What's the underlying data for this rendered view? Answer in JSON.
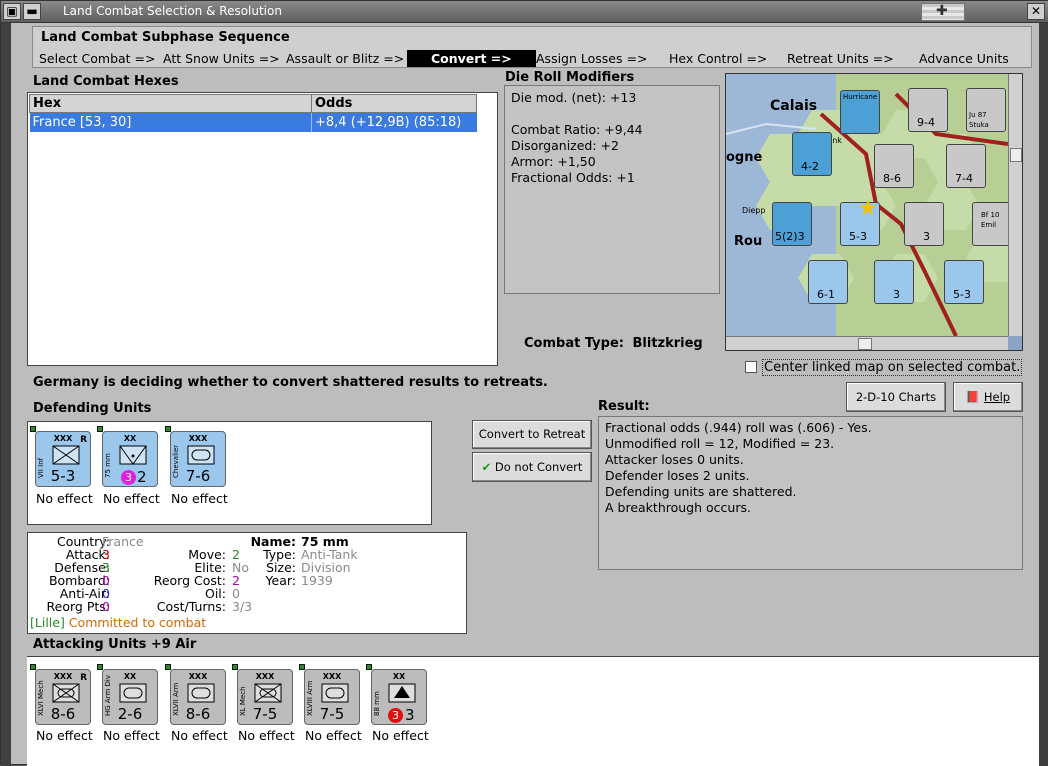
{
  "window": {
    "title": "Land Combat Selection & Resolution"
  },
  "sequence": {
    "header": "Land Combat Subphase Sequence",
    "steps": [
      "Select Combat =>",
      "Att Snow Units =>",
      "Assault or Blitz =>",
      "Convert =>",
      "Assign Losses =>",
      "Hex Control =>",
      "Retreat Units =>",
      "Advance Units"
    ],
    "active_step": "Convert =>"
  },
  "hexes": {
    "label": "Land Combat Hexes",
    "columns": [
      "Hex",
      "Odds"
    ],
    "rows": [
      {
        "hex": "France [53, 30]",
        "odds": "+8,4 (+12,9B) (85:18)"
      }
    ]
  },
  "modifiers": {
    "label": "Die Roll Modifiers",
    "lines": [
      "Die mod. (net): +13",
      "",
      "Combat Ratio: +9,44",
      "Disorganized: +2",
      "Armor: +1,50",
      "Fractional Odds: +1"
    ]
  },
  "combat_type": {
    "label": "Combat Type:",
    "value": "Blitzkrieg"
  },
  "map": {
    "place_labels": [
      "Calais",
      "ogne",
      "Rou",
      "Diepp",
      "Dunk",
      "Hurricane",
      "Ju 87",
      "Stuka",
      "Bf 10",
      "Emil"
    ],
    "center_checkbox_label": "Center linked map on selected combat."
  },
  "status_message": "Germany is deciding whether to convert shattered results to retreats.",
  "defending": {
    "label": "Defending Units",
    "units": [
      {
        "name": "VII Inf",
        "size": "XXX",
        "value": "5-3",
        "effect": "No effect",
        "reserve": "R"
      },
      {
        "name": "75 mm",
        "size": "XX",
        "value": "2",
        "badge": "3",
        "effect": "No effect"
      },
      {
        "name": "Chevalier",
        "size": "XXX",
        "value": "7-6",
        "effect": "No effect"
      }
    ]
  },
  "buttons": {
    "convert": "Convert to Retreat",
    "no_convert": "Do not Convert",
    "charts": "2-D-10 Charts",
    "help": "Help"
  },
  "result": {
    "label": "Result:",
    "lines": [
      "Fractional odds (.944) roll was (.606)  - Yes.",
      "Unmodified roll = 12, Modified = 23.",
      "Attacker loses 0 units.",
      "Defender loses 2 units.",
      "Defending units are shattered.",
      "A breakthrough occurs."
    ]
  },
  "unit_info": {
    "country_label": "Country:",
    "country": "France",
    "attack_label": "Attack:",
    "attack": "3",
    "defense_label": "Defense:",
    "defense": "3",
    "bombard_label": "Bombard:",
    "bombard": "0",
    "antiair_label": "Anti-Air:",
    "antiair": "0",
    "reorg_pts_label": "Reorg Pts:",
    "reorg_pts": "0",
    "name_label": "Name:",
    "name": "75 mm",
    "move_label": "Move:",
    "move": "2",
    "elite_label": "Elite:",
    "elite": "No",
    "reorg_cost_label": "Reorg Cost:",
    "reorg_cost": "2",
    "oil_label": "Oil:",
    "oil": "0",
    "cost_label": "Cost/Turns:",
    "cost": "3/3",
    "type_label": "Type:",
    "type": "Anti-Tank",
    "size_label": "Size:",
    "size": "Division",
    "year_label": "Year:",
    "year": "1939",
    "location": "[Lille]",
    "status": "Committed to combat"
  },
  "attacking": {
    "label": "Attacking Units +9 Air",
    "units": [
      {
        "name": "XLVI Mech",
        "size": "XXX",
        "value": "8-6",
        "effect": "No effect",
        "reserve": "R"
      },
      {
        "name": "HG Arm Div",
        "size": "XX",
        "value": "2-6",
        "effect": "No effect"
      },
      {
        "name": "XLVII Arm",
        "size": "XXX",
        "value": "8-6",
        "effect": "No effect"
      },
      {
        "name": "XL Mech",
        "size": "XXX",
        "value": "7-5",
        "effect": "No effect"
      },
      {
        "name": "XLVIII Arm",
        "size": "XXX",
        "value": "7-5",
        "effect": "No effect"
      },
      {
        "name": "88 mm",
        "size": "XX",
        "value": "3",
        "badge": "3",
        "effect": "No effect"
      }
    ]
  },
  "colors": {
    "active_step_bg": "#000000",
    "selection": "#3a7be0",
    "attack": "#cc0000",
    "defense": "#2a8a2a",
    "bombard": "#b000b0",
    "antiair": "#2020c0",
    "committed": "#d06a00"
  }
}
